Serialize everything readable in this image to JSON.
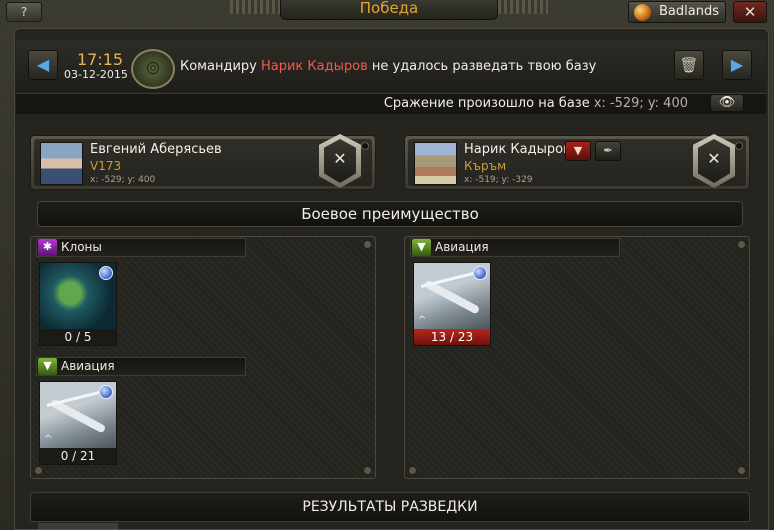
{
  "window": {
    "help_label": "?",
    "title": "Победа",
    "server": "Badlands",
    "close_label": "✕"
  },
  "report": {
    "time": "17:15",
    "date": "03-12-2015",
    "message_prefix": "Командиру ",
    "message_name": "Нарик Кадыров",
    "message_suffix": " не удалось разведать твою базу",
    "prev_label": "◀",
    "next_label": "▶",
    "trash_label": "🗑",
    "battle_text": "Сражение произошло на базе",
    "battle_coord": "x: -529; y: 400",
    "eye_label": "👁"
  },
  "players": [
    {
      "name": "Евгений Аберясьев",
      "alliance": "V173",
      "coords": "x: -529; y: 400",
      "badge": "✕"
    },
    {
      "name": "Нарик Кадыров",
      "alliance": "Къръм",
      "coords": "x: -519; y: -329",
      "badge": "✕",
      "action_red": "▼",
      "action_dark": "✒"
    }
  ],
  "advantage_title": "Боевое преимущество",
  "left_units": {
    "groups": [
      {
        "category": "Клоны",
        "icon": "clone-icon",
        "count": "0 / 5"
      },
      {
        "category": "Авиация",
        "icon": "aviation-icon",
        "count": "0 / 21"
      }
    ]
  },
  "right_units": {
    "groups": [
      {
        "category": "Авиация",
        "icon": "aviation-icon",
        "count": "13 / 23"
      }
    ]
  },
  "results_title": "РЕЗУЛЬТАТЫ РАЗВЕДКИ",
  "colors": {
    "accent_orange": "#e4a430",
    "enemy_red": "#f05a4c",
    "loss_red": "#b8261c"
  }
}
